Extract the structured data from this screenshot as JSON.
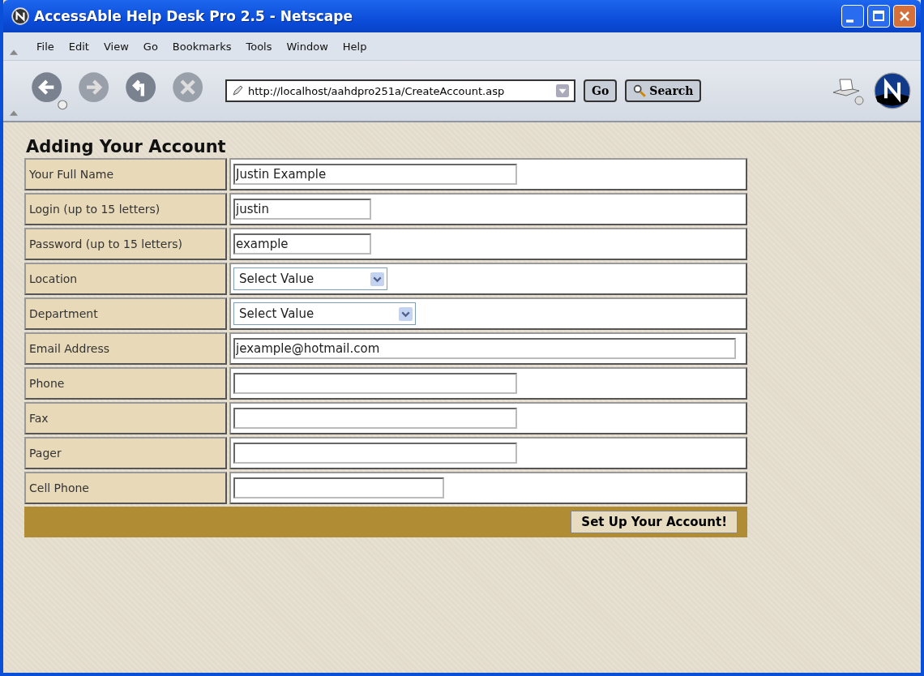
{
  "window": {
    "title": "AccessAble Help Desk Pro 2.5 - Netscape"
  },
  "menu": [
    "File",
    "Edit",
    "View",
    "Go",
    "Bookmarks",
    "Tools",
    "Window",
    "Help"
  ],
  "toolbar": {
    "url": "http://localhost/aahdpro251a/CreateAccount.asp",
    "go": "Go",
    "search": "Search"
  },
  "page": {
    "heading": "Adding Your Account",
    "fields": [
      {
        "label": "Your Full Name",
        "kind": "text",
        "value": "Justin Example"
      },
      {
        "label": "Login (up to 15 letters)",
        "kind": "text",
        "value": "justin"
      },
      {
        "label": "Password (up to 15 letters)",
        "kind": "text",
        "value": "example"
      },
      {
        "label": "Location",
        "kind": "select",
        "value": "Select Value"
      },
      {
        "label": "Department",
        "kind": "select",
        "value": "Select Value"
      },
      {
        "label": "Email Address",
        "kind": "text",
        "value": "jexample@hotmail.com"
      },
      {
        "label": "Phone",
        "kind": "text"
      },
      {
        "label": "Fax",
        "kind": "text"
      },
      {
        "label": "Pager",
        "kind": "text"
      },
      {
        "label": "Cell Phone",
        "kind": "text"
      }
    ],
    "submit": "Set Up Your Account!"
  }
}
